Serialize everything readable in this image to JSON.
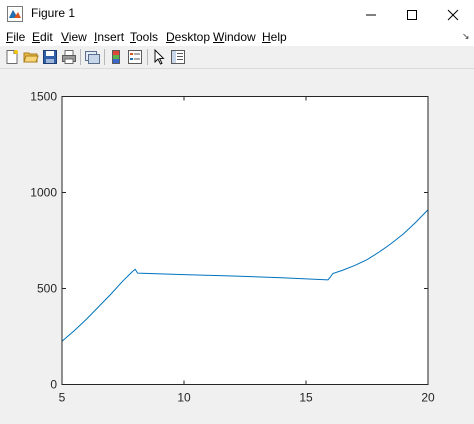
{
  "window": {
    "title": "Figure 1",
    "controls": {
      "minimize": "minimize",
      "maximize": "maximize",
      "close": "close"
    }
  },
  "menu": {
    "items": [
      "File",
      "Edit",
      "View",
      "Insert",
      "Tools",
      "Desktop",
      "Window",
      "Help"
    ]
  },
  "toolbar": {
    "buttons": [
      "new-figure",
      "open-file",
      "save",
      "print",
      "link-plot",
      "insert-colorbar",
      "insert-legend",
      "edit-plot",
      "property-inspector"
    ]
  },
  "chart_data": {
    "type": "line",
    "title": "",
    "xlabel": "",
    "ylabel": "",
    "xlim": [
      5,
      20
    ],
    "ylim": [
      0,
      1500
    ],
    "xticks": [
      5,
      10,
      15,
      20
    ],
    "yticks": [
      0,
      500,
      1000,
      1500
    ],
    "grid": false,
    "series": [
      {
        "color": "#0072BD",
        "x": [
          5,
          5.5,
          6,
          6.5,
          7,
          7.5,
          7.9,
          8.0,
          8.1,
          10,
          12,
          14,
          15.9,
          16.0,
          16.1,
          16.5,
          17,
          17.5,
          18,
          18.5,
          19,
          19.5,
          20
        ],
        "y": [
          225,
          280,
          340,
          405,
          470,
          540,
          590,
          600,
          580,
          572,
          565,
          556,
          545,
          560,
          578,
          595,
          620,
          650,
          690,
          735,
          785,
          845,
          910
        ]
      }
    ]
  }
}
